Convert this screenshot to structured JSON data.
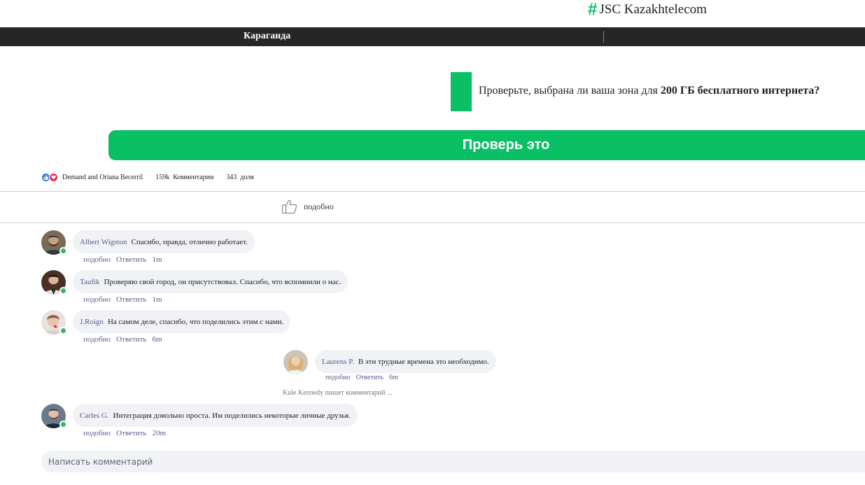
{
  "header": {
    "hash_symbol": "#",
    "title": "JSC Kazakhtelecom"
  },
  "nav": {
    "city": "Караганда"
  },
  "promo": {
    "text_before": "Проверьте, выбрана ли ваша зона для ",
    "text_bold": "200 ГБ бесплатного интернета?",
    "button_label": "Проверь это"
  },
  "reactions": {
    "names": "Demand and Oriana Becerril",
    "comments_count": "159k",
    "comments_label": "Комментарии",
    "shares_count": "343",
    "shares_label": "доля"
  },
  "like_action": {
    "label": "подобно"
  },
  "comments": [
    {
      "author": "Albert Wigston",
      "text": "Спасибо, правда, отлично работает.",
      "like": "подобно",
      "reply": "Ответить",
      "time": "1m"
    },
    {
      "author": "Taufik",
      "text": "Проверяю свой город, он присутствовал. Спасибо, что вспомнили о нас.",
      "like": "подобно",
      "reply": "Ответить",
      "time": "1m"
    },
    {
      "author": "J.Roign",
      "text": "На самом деле, спасибо, что поделились этим с нами.",
      "like": "подобно",
      "reply": "Ответить",
      "time": "6m"
    },
    {
      "author": "Laurens P.",
      "text": "В эти трудные времена это необходимо.",
      "like": "подобно",
      "reply": "Ответить",
      "time": "6m"
    },
    {
      "author": "Carles G.",
      "text": "Интеграция довольно проста. Им поделились некоторые личные друзья.",
      "like": "подобно",
      "reply": "Ответить",
      "time": "20m"
    }
  ],
  "typing_indicator": "Kule Kennedy пишет комментарий ...",
  "comment_input": {
    "placeholder": "Написать комментарий"
  },
  "colors": {
    "accent": "#09c065",
    "navbar": "#262626",
    "bubble": "#f0f2f5",
    "author": "#5a5a8f"
  }
}
